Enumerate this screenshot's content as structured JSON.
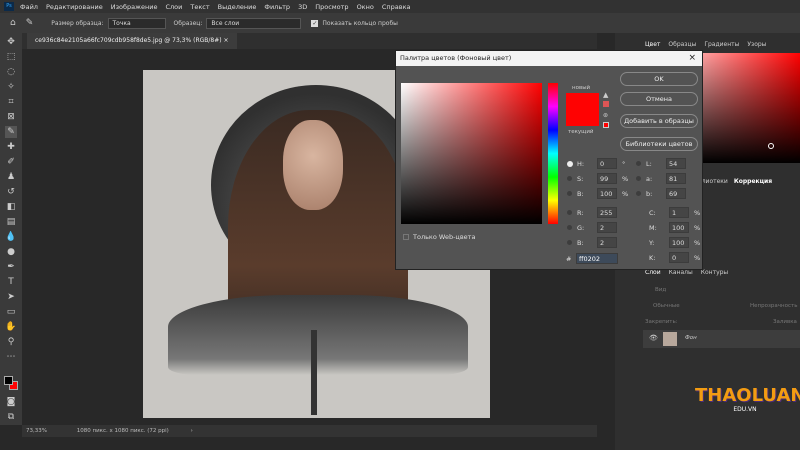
{
  "app": {
    "logo": "Ps",
    "menu": [
      "Файл",
      "Редактирование",
      "Изображение",
      "Слои",
      "Текст",
      "Выделение",
      "Фильтр",
      "3D",
      "Просмотр",
      "Окно",
      "Справка"
    ]
  },
  "options": {
    "sample_size_label": "Размер образца:",
    "sample_size_value": "Точка",
    "sample_label": "Образец:",
    "sample_value": "Все слои",
    "show_ring_label": "Показать кольцо пробы",
    "show_ring_checked": true
  },
  "document": {
    "tab_title": "ce936c84e2105a66fc709cdb958f8de5.jpg @ 73,3% (RGB/8#)",
    "zoom": "73,33%",
    "size_info": "1080 пикс. x 1080 пикс. (72 ppi)"
  },
  "dialog": {
    "title": "Палитра цветов (Фоновый цвет)",
    "new_label": "новый",
    "current_label": "текущий",
    "ok": "OK",
    "cancel": "Отмена",
    "add_to_swatches": "Добавить в образцы",
    "color_libraries": "Библиотеки цветов",
    "web_only": "Только Web-цвета",
    "hex": "ff0202",
    "new_color": "#ff0202",
    "current_color": "#ff0202",
    "hsb": [
      {
        "label": "H:",
        "value": "0",
        "unit": "°"
      },
      {
        "label": "S:",
        "value": "99",
        "unit": "%"
      },
      {
        "label": "B:",
        "value": "100",
        "unit": "%"
      }
    ],
    "rgb": [
      {
        "label": "R:",
        "value": "255"
      },
      {
        "label": "G:",
        "value": "2"
      },
      {
        "label": "B:",
        "value": "2"
      }
    ],
    "lab": [
      {
        "label": "L:",
        "value": "54"
      },
      {
        "label": "a:",
        "value": "81"
      },
      {
        "label": "b:",
        "value": "69"
      }
    ],
    "cmyk": [
      {
        "label": "C:",
        "value": "1",
        "unit": "%"
      },
      {
        "label": "M:",
        "value": "100",
        "unit": "%"
      },
      {
        "label": "Y:",
        "value": "100",
        "unit": "%"
      },
      {
        "label": "K:",
        "value": "0",
        "unit": "%"
      }
    ]
  },
  "panels": {
    "color_tabs": [
      "Цвет",
      "Образцы",
      "Градиенты",
      "Узоры"
    ],
    "adjust_tabs": [
      "Библиотеки",
      "Коррекция"
    ],
    "layers_tabs": [
      "Слои",
      "Каналы",
      "Контуры"
    ],
    "layers_search": "Вид",
    "blend_mode": "Обычные",
    "opacity_label": "Непрозрачность",
    "lock_label": "Закрепить:",
    "fill_label": "Заливка",
    "layer_name": "Фон"
  },
  "watermark": "THAOLUAN EDU.VN",
  "colors": {
    "foreground": "#000000",
    "background": "#ff0202",
    "accent": "#1473e6"
  }
}
